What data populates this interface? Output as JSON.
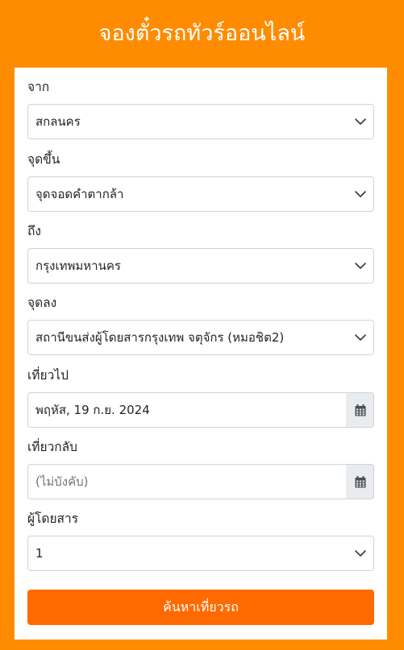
{
  "header": {
    "title": "จองตั๋วรถทัวร์ออนไลน์"
  },
  "form": {
    "from": {
      "label": "จาก",
      "value": "สกลนคร"
    },
    "boarding_point": {
      "label": "จุดขึ้น",
      "value": "จุดจอดคำตากล้า"
    },
    "to": {
      "label": "ถึง",
      "value": "กรุงเทพมหานคร"
    },
    "drop_point": {
      "label": "จุดลง",
      "value": "สถานีขนส่งผู้โดยสารกรุงเทพ จตุจักร (หมอชิต2)"
    },
    "departure_date": {
      "label": "เที่ยวไป",
      "value": "พฤหัส, 19 ก.ย. 2024"
    },
    "return_date": {
      "label": "เที่ยวกลับ",
      "placeholder": "(ไม่บังคับ)"
    },
    "passengers": {
      "label": "ผู้โดยสาร",
      "value": "1"
    },
    "search_label": "ค้นหาเที่ยวรถ"
  },
  "icons": {
    "select": "chevron-down-icon",
    "date": "calendar-icon"
  },
  "colors": {
    "background": "#FF8C00",
    "button": "#FF6A00",
    "addon": "#e9ecef"
  }
}
